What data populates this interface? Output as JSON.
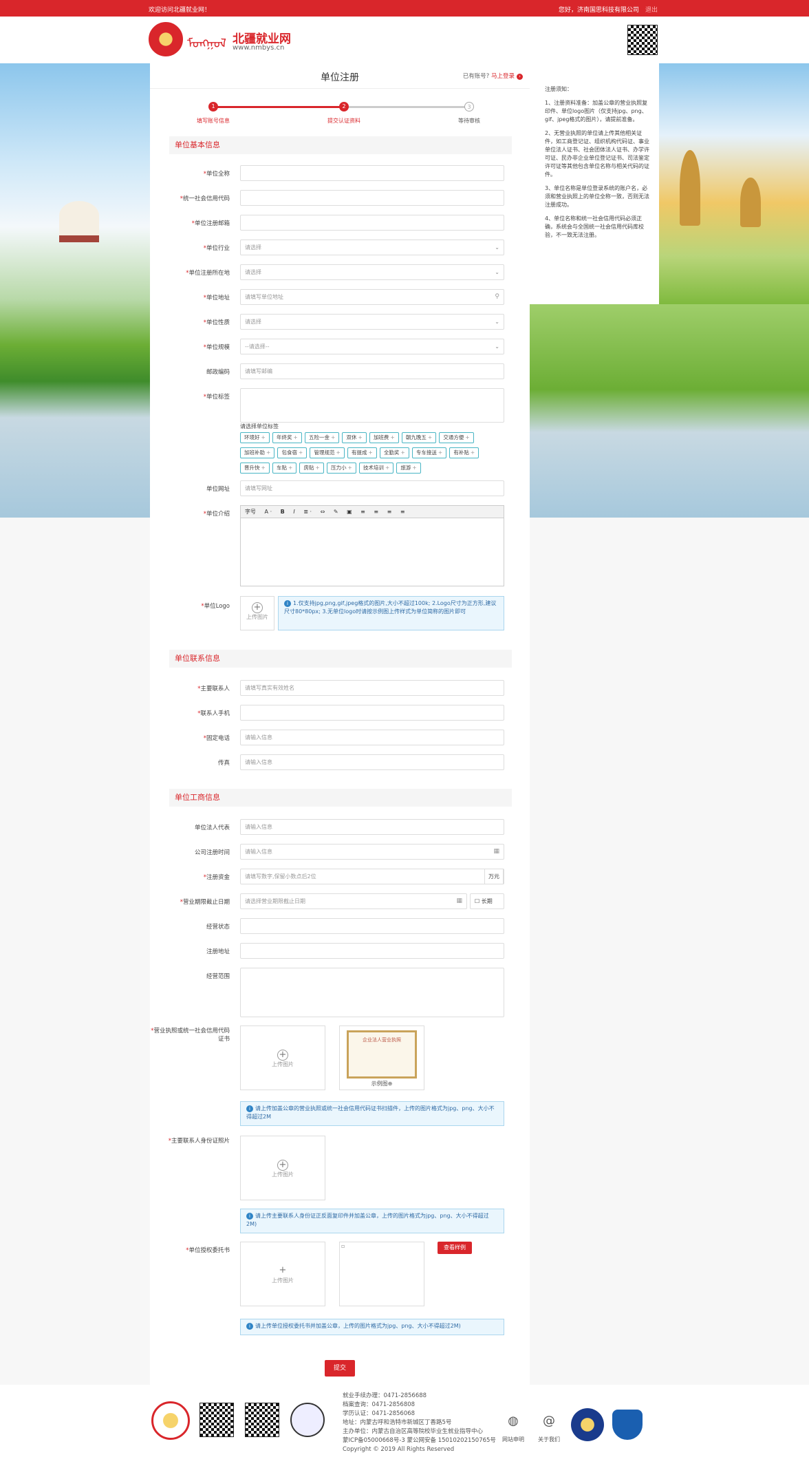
{
  "topbar": {
    "welcome": "欢迎访问北疆就业网！",
    "greeting": "您好，济南国思科技有限公司",
    "logout": "退出"
  },
  "header": {
    "mongol": "ᠮᠣᠩᠭᠣᠯ",
    "site_name": "北疆就业网",
    "site_url": "www.nmbys.cn"
  },
  "page": {
    "title": "单位注册",
    "have_account": "已有账号?",
    "login_link": "马上登录"
  },
  "steps": [
    {
      "label": "填写账号信息",
      "num": "1"
    },
    {
      "label": "提交认证资料",
      "num": "2"
    },
    {
      "label": "等待审核",
      "num": "3"
    }
  ],
  "colors": {
    "brand": "#d9262b",
    "tag_border": "#48b5c4",
    "note_bg": "#eaf6fd"
  },
  "sections": {
    "basic": "单位基本信息",
    "contact": "单位联系信息",
    "business": "单位工商信息"
  },
  "basic": {
    "full_name": "单位全称",
    "credit_code": "统一社会信用代码",
    "email": "单位注册邮箱",
    "industry": "单位行业",
    "industry_ph": "请选择",
    "region": "单位注册所在地",
    "region_ph": "请选择",
    "address": "单位地址",
    "address_ph": "请填写单位地址",
    "nature": "单位性质",
    "nature_ph": "请选择",
    "scale": "单位规模",
    "scale_ph": "--请选择--",
    "postcode": "邮政编码",
    "postcode_ph": "请填写邮编",
    "tags_label": "单位标签",
    "tags_title": "请选择单位标签",
    "website": "单位网址",
    "website_ph": "请填写网址",
    "intro": "单位介绍",
    "logo": "单位Logo",
    "upload": "上传图片",
    "logo_note": "1.仅支持jpg,png,gif,jpeg格式的图片,大小不超过100k; 2.Logo尺寸为正方形,建议尺寸80*80px; 3.无单位logo时请按示例图上传样式为单位简称的图片即可"
  },
  "tags": [
    "环境好",
    "年终奖",
    "五险一金",
    "双休",
    "加班费",
    "朝九晚五",
    "交通方便",
    "加班补助",
    "包食宿",
    "管理规范",
    "有提成",
    "全勤奖",
    "专车接送",
    "有补贴",
    "晋升快",
    "车贴",
    "房贴",
    "压力小",
    "技术培训",
    "旅游"
  ],
  "editor": {
    "font_size": "字号",
    "tools": [
      "A ·",
      "B",
      "I",
      "≣ ·",
      "⇔",
      "✎",
      "▣",
      "≡",
      "≡",
      "≡",
      "≡"
    ]
  },
  "contact": {
    "person": "主要联系人",
    "person_ph": "请填写真实有效姓名",
    "mobile": "联系人手机",
    "phone": "固定电话",
    "phone_ph": "请输入信息",
    "fax": "传真",
    "fax_ph": "请输入信息"
  },
  "business": {
    "legal": "单位法人代表",
    "legal_ph": "请输入信息",
    "reg_date": "公司注册时间",
    "reg_date_ph": "请输入信息",
    "capital": "注册资金",
    "capital_ph": "请填写数字,保留小数点后2位",
    "capital_unit": "万元",
    "term": "营业期限截止日期",
    "term_ph": "请选择营业期限截止日期",
    "long_term": "长期",
    "status": "经营状态",
    "reg_addr": "注册地址",
    "scope": "经营范围",
    "license": "营业执照或统一社会信用代码证书",
    "sample": "示例图",
    "sample_title": "企业法人营业执照",
    "license_note": "请上传加盖公章的营业执照或统一社会信用代码证书扫描件，上传的图片格式为jpg、png、大小不得超过2M",
    "idcard": "主要联系人身份证照片",
    "idcard_note": "请上传主要联系人身份证正反面复印件并加盖公章，上传的图片格式为jpg、png、大小不得超过2M)",
    "auth": "单位授权委托书",
    "view_sample": "查看样例",
    "auth_note": "请上传单位授权委托书并加盖公章，上传的图片格式为jpg、png、大小不得超过2M)"
  },
  "submit": "提交",
  "footer": {
    "lines": [
      "就业手续办理：0471-2856688",
      "档案查询：0471-2856808",
      "学历认证：0471-2856068",
      "地址：内蒙古呼和浩特市新城区丁香路5号",
      "主办单位：内蒙古自治区高等院校毕业生就业指导中心",
      "蒙ICP备05000668号-3 蒙公网安备 15010202150765号",
      "Copyright © 2019 All Rights Reserved"
    ],
    "site_apply": "网站申明",
    "about": "关于我们"
  }
}
